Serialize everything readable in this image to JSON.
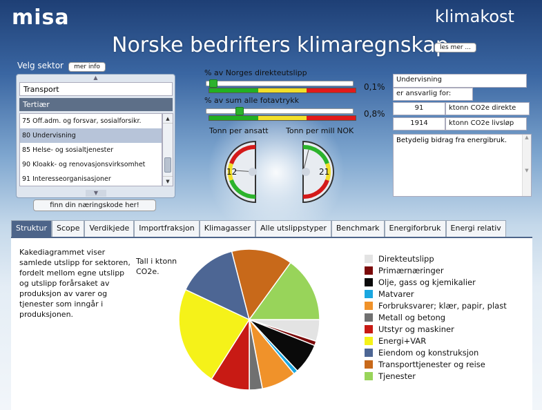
{
  "header": {
    "logo_left": "misa",
    "logo_right": "klimakost",
    "title": "Norske bedrifters klimaregnskap",
    "les_mer": "les mer ..."
  },
  "sector": {
    "label": "Velg sektor",
    "mer_info": "mer info",
    "main_value": "Transport",
    "sub_value": "Tertiær",
    "list": [
      "75 Off.adm. og forsvar, sosialforsikr.",
      "80 Undervisning",
      "85 Helse- og sosialtjenester",
      "90 Kloakk- og renovasjonsvirksomhet",
      "91 Interesseorganisasjoner"
    ],
    "selected_index": 1,
    "finn_button": "finn din næringskode her!"
  },
  "share": {
    "direct_label": "% av Norges direkteutslipp",
    "direct_value": "0,1%",
    "direct_level": 0.02,
    "footprint_label": "% av sum alle fotavtrykk",
    "footprint_value": "0,8%",
    "footprint_level": 0.21
  },
  "gauges": {
    "per_employee_label": "Tonn per ansatt",
    "per_employee_value": "12",
    "per_mnok_label": "Tonn per mill NOK",
    "per_mnok_value": "21"
  },
  "info": {
    "sector_name": "Undervisning",
    "responsible_label": "er ansvarlig for:",
    "direct_amount": "91",
    "direct_unit": "ktonn CO2e direkte",
    "lifecycle_amount": "1914",
    "lifecycle_unit": "ktonn CO2e livsløp",
    "comment": "Betydelig bidrag fra energibruk."
  },
  "tabs": [
    {
      "label": "Struktur",
      "active": true
    },
    {
      "label": "Scope",
      "active": false
    },
    {
      "label": "Verdikjede",
      "active": false
    },
    {
      "label": "Importfraksjon",
      "active": false
    },
    {
      "label": "Klimagasser",
      "active": false
    },
    {
      "label": "Alle utslippstyper",
      "active": false
    },
    {
      "label": "Benchmark",
      "active": false
    },
    {
      "label": "Energiforbruk",
      "active": false
    },
    {
      "label": "Energi relativ",
      "active": false
    }
  ],
  "panel": {
    "description": "Kakediagrammet viser samlede utslipp for sektoren, fordelt mellom egne utslipp og utslipp forårsaket av produksjon av varer og tjenester som inngår i produksjonen.",
    "unit_note": "Tall i ktonn CO2e."
  },
  "chart_data": {
    "type": "pie",
    "title": "",
    "slices": [
      {
        "name": "Direkteutslipp",
        "value": 5,
        "color": "#e3e3e3"
      },
      {
        "name": "Primærnæringer",
        "value": 1,
        "color": "#7b0a0a"
      },
      {
        "name": "Olje, gass og kjemikalier",
        "value": 7,
        "color": "#0a0a0a"
      },
      {
        "name": "Matvarer",
        "value": 1,
        "color": "#1aa7e0"
      },
      {
        "name": "Forbruksvarer; klær, papir, plast",
        "value": 8,
        "color": "#f0922a"
      },
      {
        "name": "Metall og betong",
        "value": 3,
        "color": "#707070"
      },
      {
        "name": "Utstyr og maskiner",
        "value": 9,
        "color": "#c81a14"
      },
      {
        "name": "Energi+VAR",
        "value": 23,
        "color": "#f5f219"
      },
      {
        "name": "Eiendom og konstruksjon",
        "value": 14,
        "color": "#4d6694"
      },
      {
        "name": "Transporttjenester og reise",
        "value": 14,
        "color": "#c8691a"
      },
      {
        "name": "Tjenester",
        "value": 15,
        "color": "#98d45a"
      }
    ]
  }
}
